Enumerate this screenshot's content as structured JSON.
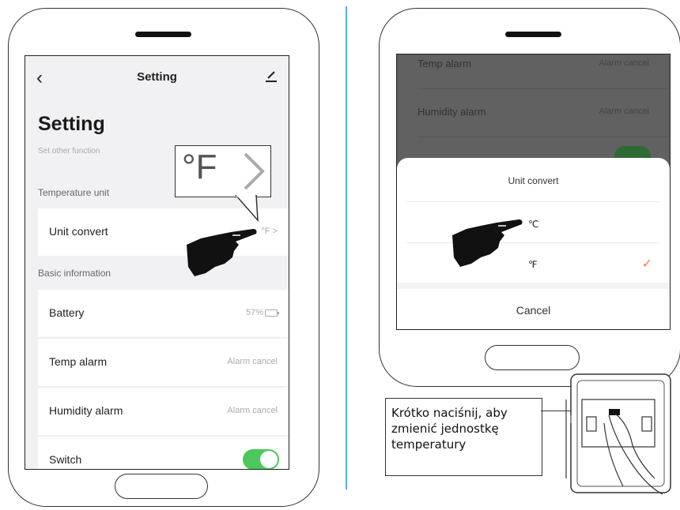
{
  "left_phone": {
    "nav": {
      "back_icon": "chevron-left-icon",
      "title": "Setting",
      "edit_icon": "edit-pen-icon"
    },
    "page_title": "Setting",
    "subtitle": "Set other function",
    "sections": {
      "temperature": "Temperature unit",
      "basic": "Basic information"
    },
    "rows": {
      "unit_convert": {
        "label": "Unit convert",
        "value": "°F >"
      },
      "battery": {
        "label": "Battery",
        "value": "57%"
      },
      "temp_alarm": {
        "label": "Temp alarm",
        "value": "Alarm cancel"
      },
      "humidity_alarm": {
        "label": "Humidity alarm",
        "value": "Alarm cancel"
      },
      "switch": {
        "label": "Switch",
        "on": true
      }
    },
    "callout": {
      "text": "°F"
    }
  },
  "right_phone": {
    "background_rows": {
      "temp_alarm": {
        "label": "Temp alarm",
        "value": "Alarm cancel"
      },
      "humidity_alarm": {
        "label": "Humidity alarm",
        "value": "Alarm cancel"
      }
    },
    "sheet": {
      "title": "Unit convert",
      "options": [
        "℃",
        "℉"
      ],
      "selected": "℉",
      "cancel_label": "Cancel"
    }
  },
  "instruction": {
    "text": "Krótko naciśnij, aby zmienić jednostkę temperatury"
  },
  "colors": {
    "toggle_on": "#4cc85c",
    "check": "#ff7a45",
    "divider": "#4fb3d9"
  }
}
